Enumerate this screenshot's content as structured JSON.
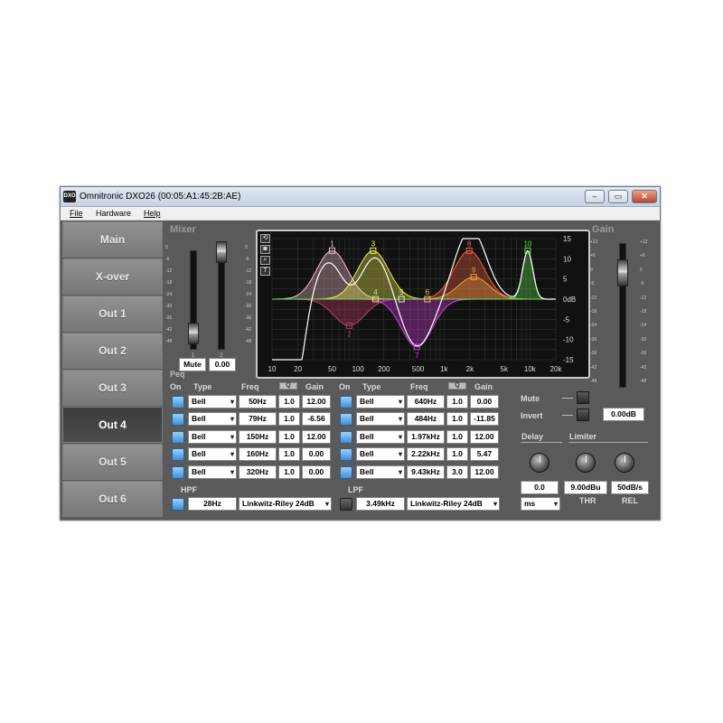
{
  "window": {
    "title": "Omnitronic DXO26 (00:05:A1:45:2B:AE)",
    "icon_text": "DXO",
    "minimize_icon": "minimize-icon",
    "maximize_icon": "maximize-icon",
    "close_icon": "close-icon"
  },
  "menu": {
    "file": "File",
    "hardware": "Hardware",
    "help": "Help"
  },
  "nav": [
    "Main",
    "X-over",
    "Out 1",
    "Out 2",
    "Out 3",
    "Out 4",
    "Out 5",
    "Out 6"
  ],
  "nav_active": "Out 4",
  "mixer": {
    "title": "Mixer",
    "channel_1": "1",
    "channel_2": "2",
    "mute_label": "Mute",
    "value": "0.00",
    "scale": [
      "0",
      "-6",
      "-12",
      "-18",
      "-24",
      "-30",
      "-36",
      "-42",
      "-48"
    ]
  },
  "graph": {
    "x_labels": [
      "10",
      "20",
      "50",
      "100",
      "200",
      "500",
      "1k",
      "2k",
      "5k",
      "10k",
      "20k"
    ],
    "y_labels": [
      "15",
      "10",
      "5",
      "0dB",
      "-5",
      "-10",
      "-15"
    ],
    "band_numbers": [
      "1",
      "2",
      "3",
      "4",
      "5",
      "6",
      "7",
      "8",
      "9",
      "10"
    ],
    "tool_icons": [
      "reset-icon",
      "camera-icon",
      "zoom-icon",
      "text-icon"
    ]
  },
  "peq": {
    "title": "Peq",
    "headers": {
      "on": "On",
      "type": "Type",
      "freq": "Freq",
      "q": "Q",
      "gain": "Gain"
    },
    "left_bands": [
      {
        "type": "Bell",
        "freq": "50Hz",
        "q": "1.0",
        "gain": "12.00"
      },
      {
        "type": "Bell",
        "freq": "79Hz",
        "q": "1.0",
        "gain": "-6.56"
      },
      {
        "type": "Bell",
        "freq": "150Hz",
        "q": "1.0",
        "gain": "12.00"
      },
      {
        "type": "Bell",
        "freq": "160Hz",
        "q": "1.0",
        "gain": "0.00"
      },
      {
        "type": "Bell",
        "freq": "320Hz",
        "q": "1.0",
        "gain": "0.00"
      }
    ],
    "right_bands": [
      {
        "type": "Bell",
        "freq": "640Hz",
        "q": "1.0",
        "gain": "0.00"
      },
      {
        "type": "Bell",
        "freq": "484Hz",
        "q": "1.0",
        "gain": "-11.85"
      },
      {
        "type": "Bell",
        "freq": "1.97kHz",
        "q": "1.0",
        "gain": "12.00"
      },
      {
        "type": "Bell",
        "freq": "2.22kHz",
        "q": "1.0",
        "gain": "5.47"
      },
      {
        "type": "Bell",
        "freq": "9.43kHz",
        "q": "3.0",
        "gain": "12.00"
      }
    ]
  },
  "hpf": {
    "label": "HPF",
    "freq": "28Hz",
    "type": "Linkwitz-Riley 24dB"
  },
  "lpf": {
    "label": "LPF",
    "freq": "3.49kHz",
    "type": "Linkwitz-Riley 24dB"
  },
  "gain": {
    "title": "Gain",
    "value": "0.00dB",
    "scale": [
      "+12",
      "+6",
      "0",
      "-6",
      "-12",
      "-18",
      "-24",
      "-30",
      "-36",
      "-42",
      "-48"
    ]
  },
  "controls": {
    "mute": "Mute",
    "invert": "Invert"
  },
  "delay": {
    "title": "Delay",
    "value": "0.0",
    "unit": "ms"
  },
  "limiter": {
    "title": "Limiter",
    "thr_value": "9.00dBu",
    "thr_label": "THR",
    "rel_value": "50dB/s",
    "rel_label": "REL"
  },
  "colors": {
    "active_checkbox": "#3d8fd6",
    "panel_bg": "#5a5a5a",
    "graph_bg": "#111111"
  }
}
